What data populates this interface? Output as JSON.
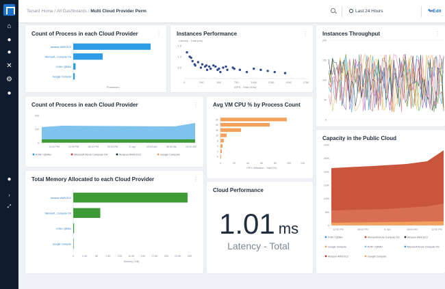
{
  "breadcrumb": {
    "tenant": "Tenant Home",
    "sep": "/",
    "dashboards": "All Dashboards",
    "current": "Multi Cloud Provider Perm"
  },
  "toolbar": {
    "time_range": "Last 24 Hours",
    "edit_label": "Edit"
  },
  "colors": {
    "blue": "#2e9be6",
    "orange": "#f4a25b",
    "green": "#3d9b35",
    "red": "#c5452f",
    "navy": "#0f1b2e"
  },
  "panels": {
    "process_count": {
      "title": "Count of Process in each Cloud Provider",
      "categories": [
        "Amazon AWS EC2",
        "Microsoft...Compute OS",
        "KVM / QEMU",
        "Google Compute"
      ],
      "values": [
        100,
        38,
        3,
        2
      ],
      "xlabel": "Processes"
    },
    "instances_perf": {
      "title": "Instances Performance",
      "ylabel": "Latency - Total (ms)",
      "xlabel": "IOPS - Total (IO/s)",
      "xticks": [
        "0",
        "250",
        "500",
        "750",
        "1000",
        "1250",
        "1500",
        "1750"
      ],
      "yticks": [
        "1.5",
        "1.0",
        "0.5"
      ],
      "points": [
        [
          40,
          1.5
        ],
        [
          80,
          1.3
        ],
        [
          100,
          1.25
        ],
        [
          120,
          1.1
        ],
        [
          150,
          0.95
        ],
        [
          160,
          0.9
        ],
        [
          200,
          1.05
        ],
        [
          240,
          0.8
        ],
        [
          260,
          0.95
        ],
        [
          300,
          0.85
        ],
        [
          320,
          0.9
        ],
        [
          330,
          0.7
        ],
        [
          360,
          0.85
        ],
        [
          380,
          0.75
        ],
        [
          420,
          0.9
        ],
        [
          450,
          0.85
        ],
        [
          480,
          0.7
        ],
        [
          500,
          0.75
        ],
        [
          520,
          0.6
        ],
        [
          560,
          0.8
        ],
        [
          600,
          0.85
        ],
        [
          620,
          0.7
        ],
        [
          700,
          0.8
        ],
        [
          720,
          0.75
        ],
        [
          800,
          0.7
        ],
        [
          900,
          0.6
        ],
        [
          1000,
          0.75
        ],
        [
          1100,
          0.7
        ],
        [
          1200,
          0.65
        ],
        [
          1300,
          0.6
        ],
        [
          1450,
          0.55
        ]
      ]
    },
    "instances_throughput": {
      "title": "Instances Throughput",
      "yticks": [
        "200",
        "150",
        "100",
        "50",
        "0"
      ]
    },
    "process_count_time": {
      "title": "Count of Process in each Cloud Provider",
      "yticks": [
        "200",
        "100",
        "0"
      ],
      "xticks": [
        "12:00 PM",
        "03:00 PM",
        "06:00 PM",
        "09:00 PM",
        "6. Apr",
        "03:00 AM",
        "06:00 AM",
        "09:00 AM"
      ],
      "legend": [
        "KVM / QEMU",
        "Microsoft Azure Compute OS",
        "Amazon AWS EC2",
        "Google Compute"
      ]
    },
    "avg_vm_cpu": {
      "title": "Avg VM CPU % by Process Count",
      "categories": [
        "60",
        "40",
        "20",
        "10",
        "8",
        "4",
        "2",
        "0"
      ],
      "values": [
        97,
        72,
        30,
        9,
        5,
        3,
        2,
        1
      ],
      "xticks": [
        "0",
        "20",
        "40",
        "60",
        "80",
        "100",
        "120"
      ],
      "xlabel": "CPU Utilization - Total (%)"
    },
    "total_memory": {
      "title": "Total Memory Allocated to each Cloud Provider",
      "categories": [
        "Amazon AWS EC2",
        "Microsoft...Compute OS",
        "KVM / QEMU",
        "Google Compute"
      ],
      "values": [
        27.5,
        6.5,
        0.2,
        0.1
      ],
      "xticks": [
        "0",
        "2.5K",
        "5K",
        "7.5K",
        "10K",
        "12.5K",
        "15K",
        "17.5K",
        "20K",
        "22.5K",
        "25K"
      ],
      "xlabel": "Memory (GB)"
    },
    "cloud_performance": {
      "title": "Cloud Performance",
      "value": "1.01",
      "unit": "ms",
      "label": "Latency - Total"
    },
    "capacity": {
      "title": "Capacity in the Public Cloud",
      "yticks": [
        "300K",
        "250K",
        "200K",
        "150K",
        "100K",
        "50K",
        "0"
      ],
      "xticks": [
        "12:00 PM",
        "06:00 PM",
        "6. Apr",
        "06:00 AM",
        "12:00 PM"
      ],
      "legend": [
        "KVM / QEMU",
        "Microsoft Azure Compute OS",
        "Amazon AWS EC2",
        "Google Compute",
        "KVM / QEMU",
        "Microsoft Azure Compute OS",
        "Amazon AWS EC2",
        "Google Compute"
      ]
    }
  }
}
